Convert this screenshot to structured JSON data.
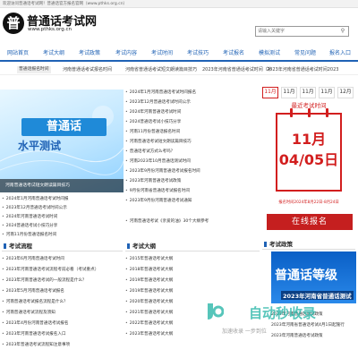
{
  "topbar": {
    "text": "欢迎访问普通话考试网！普通话官方报名官网（www.pthks.org.cn）"
  },
  "header": {
    "logo_char": "普",
    "site_name": "普通话考试网",
    "site_url": "www.pthks.org.cn",
    "search_placeholder": "请输入关键字"
  },
  "nav": {
    "items": [
      "网站首页",
      "考试大纲",
      "考试政策",
      "考试内容",
      "考试时间",
      "考试技巧",
      "考试报名",
      "模拟测试",
      "常见问题",
      "报名入口"
    ]
  },
  "ticker": {
    "label": "普通话报名时间",
    "items": [
      "河南普通话考试报名时间",
      "河南省普通话考试短文朗读篇目技巧",
      "2023年河南省普通话考试时间（补",
      "2023年河南省普通话考试时间2023",
      "2023年河南普通话考试报名日程",
      "普1"
    ]
  },
  "banner": {
    "title": "普通话",
    "subtitle": "水平测试",
    "caption": "河南普通话考试短文朗读篇目技巧"
  },
  "mid_list": [
    "2024年1月河南普通话考试时间报名",
    "2023年12月普通话考试时间公示",
    "2024年河南普通话考试时间",
    "2024普通话考试小技巧分享",
    "河南11月份普通话报名时间",
    "河南普通话考试短文朗读篇目技巧",
    "普通话考试方式么考吗？",
    "河南2023年10月普通话测试时间",
    "2023年9月份河南普通话考试报名时间",
    "2023年河南普通话考试政策",
    "9月份河南省普通话考试报名时间",
    "2023年9月份河南普通话考试通知",
    "河南普通话考试《亲爱的油》30个大纲参考"
  ],
  "left_list": [
    "2024年1月河南普通话考试时间报",
    "2023年12月普通话考试时间公示",
    "2024年河南普通话考试时间",
    "2024普通话考试小技巧分享",
    "河南11月份普通话报名时间"
  ],
  "date_tabs": {
    "items": [
      "11月",
      "11月",
      "11月",
      "11月",
      "12月",
      "12月"
    ],
    "active_index": 0
  },
  "exam_time": {
    "label": "最近考试时间",
    "date_text": "11月04/05日",
    "note": "报名时间2024年8月22日-8月24日",
    "signup_label": "在线报名"
  },
  "section_flow": {
    "title": "考试流程",
    "items": [
      "2023年6月河南普通话考试时间",
      "2023年河南普通话考试流程考前必看（考试重点）",
      "2023年河南普通话考试的一般流程是什么？",
      "2023年5月河南普通话考试报名",
      "河南普通话考试报名流程是什么？",
      "河南普通话考试流程及须知",
      "2023年4月份河南普通话考试报名",
      "2023年河南普通话考试报名入口",
      "2023年普通话考试流程知注意事项"
    ]
  },
  "section_syllabus": {
    "title": "考试大纲",
    "items": [
      "2015年普通话考试大纲",
      "2018年普通话考试大纲",
      "2019年普通话考试大纲",
      "2019年普通话考试大纲",
      "2020年普通话考试大纲",
      "2021年普通话考试大纲",
      "2022年普通话考试大纲",
      "2023年普通话考试大纲"
    ]
  },
  "section_policy": {
    "title": "考试政策",
    "image_big": "普通话等级",
    "image_small": "2023年河南省普通话测试",
    "items": [
      "2023年河南普通话测试政策",
      "2023年河南省普通话考试4月1日起施行",
      "2023年河南普通话考试政策"
    ]
  },
  "watermark": {
    "text": "自动秒收录",
    "sub": "加速收录 一步到位"
  },
  "colors": {
    "brand_blue": "#1f62b5",
    "accent_red": "#d21e1e"
  }
}
